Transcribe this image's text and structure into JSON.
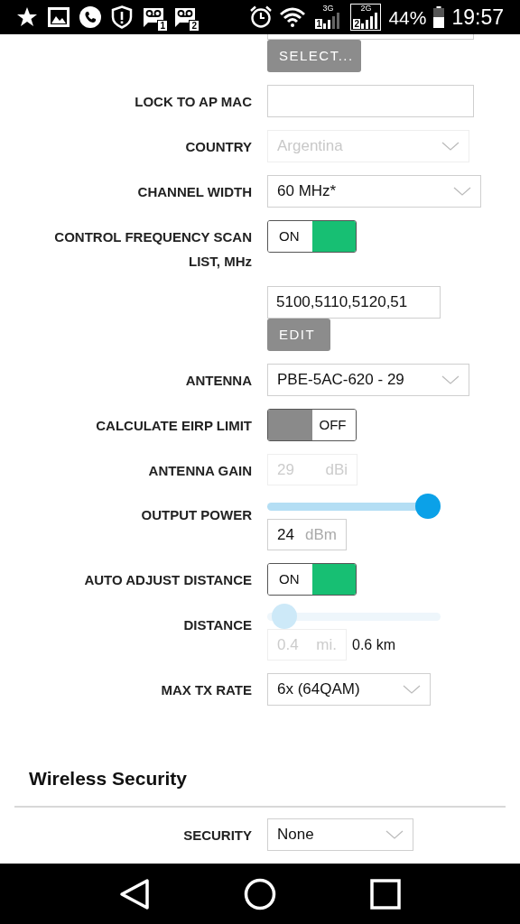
{
  "status_bar": {
    "notification_icons": [
      {
        "kind": "star"
      },
      {
        "kind": "image"
      },
      {
        "kind": "phone"
      },
      {
        "kind": "alert"
      },
      {
        "kind": "voicemail",
        "sim": "1"
      },
      {
        "kind": "voicemail",
        "sim": "2"
      }
    ],
    "signals": [
      {
        "network": "3G",
        "sim": "1",
        "selected": false
      },
      {
        "network": "2G",
        "sim": "2",
        "selected": true
      }
    ],
    "battery": "44%",
    "time": "19:57"
  },
  "form": [
    {
      "kind": "input"
    },
    {
      "kind": "button",
      "text": "SELECT..."
    },
    {
      "kind": "input",
      "label": "LOCK TO AP MAC"
    },
    {
      "kind": "select",
      "label": "COUNTRY",
      "value": "Argentina",
      "disabled": true
    },
    {
      "kind": "select",
      "label": "CHANNEL WIDTH",
      "value": "60 MHz*",
      "disabled": false
    },
    {
      "kind": "toggle",
      "label": "CONTROL FREQUENCY SCAN LIST, MHz",
      "on": true,
      "text": "ON"
    },
    {
      "kind": "input",
      "value": "5100,5110,5120,51"
    },
    {
      "kind": "button",
      "text": "EDIT"
    },
    {
      "kind": "select",
      "label": "ANTENNA",
      "value": "PBE-5AC-620 - 29",
      "disabled": false
    },
    {
      "kind": "toggle",
      "label": "CALCULATE EIRP LIMIT",
      "on": false,
      "text": "OFF"
    },
    {
      "kind": "unit",
      "label": "ANTENNA GAIN",
      "value": "29",
      "unit": "dBi",
      "disabled": true
    },
    {
      "kind": "slider",
      "label": "OUTPUT POWER",
      "level": 0.92,
      "value": "24",
      "unit": "dBm",
      "disabled": false
    },
    {
      "kind": "toggle",
      "label": "AUTO ADJUST DISTANCE",
      "on": true,
      "text": "ON"
    },
    {
      "kind": "slider",
      "label": "DISTANCE",
      "level": 0.03,
      "value": "0.4",
      "unit": "mi.",
      "reading": "0.6 km",
      "disabled": true
    },
    {
      "kind": "select",
      "label": "MAX TX RATE",
      "value": "6x (64QAM)",
      "disabled": false
    }
  ],
  "sections": [
    {
      "title": "Wireless Security",
      "form": [
        {
          "kind": "select",
          "label": "SECURITY",
          "value": "None",
          "disabled": false
        }
      ]
    }
  ]
}
